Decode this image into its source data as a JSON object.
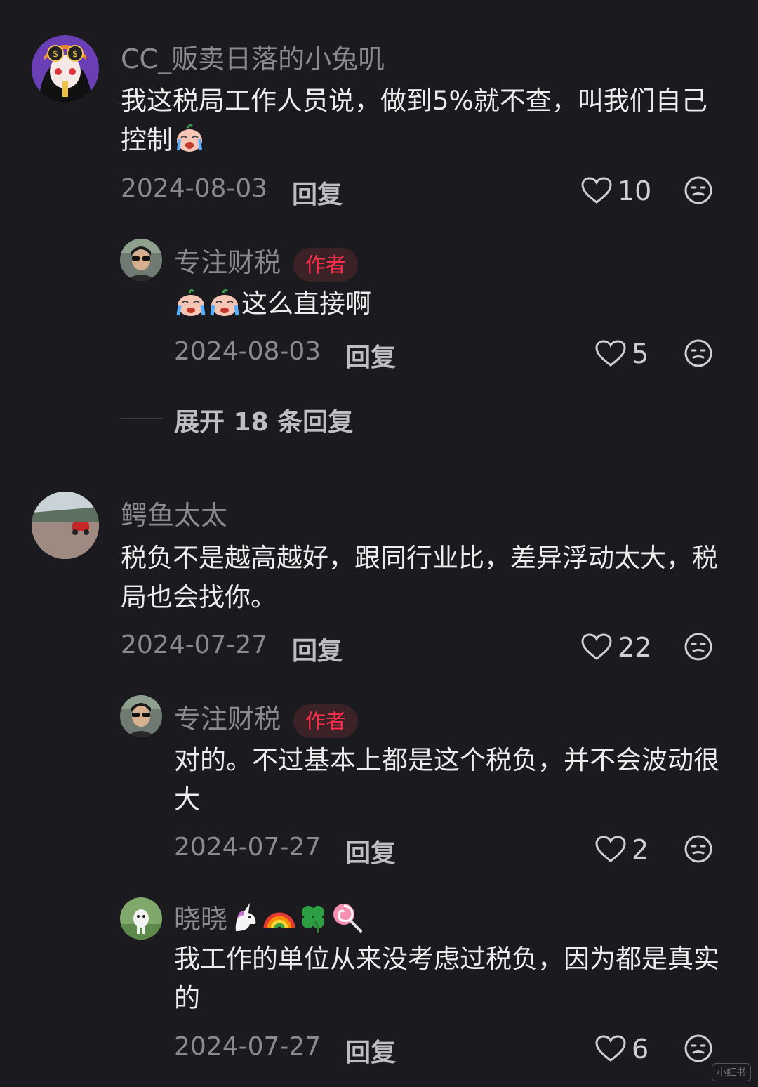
{
  "comments": [
    {
      "username": "CC_贩卖日落的小兔叽",
      "content": "我这税局工作人员说，做到5%就不查，叫我们自己控制",
      "date": "2024-08-03",
      "reply_label": "回复",
      "likes": "10",
      "replies": [
        {
          "username": "专注财税",
          "badge": "作者",
          "content": "这么直接啊",
          "date": "2024-08-03",
          "reply_label": "回复",
          "likes": "5"
        }
      ],
      "expand_label": "展开 18 条回复"
    },
    {
      "username": "鳄鱼太太",
      "content": "税负不是越高越好，跟同行业比，差异浮动太大，税局也会找你。",
      "date": "2024-07-27",
      "reply_label": "回复",
      "likes": "22",
      "replies": [
        {
          "username": "专注财税",
          "badge": "作者",
          "content": "对的。不过基本上都是这个税负，并不会波动很大",
          "date": "2024-07-27",
          "reply_label": "回复",
          "likes": "2"
        },
        {
          "username": "晓晓",
          "content": "我工作的单位从来没考虑过税负，因为都是真实的",
          "date": "2024-07-27",
          "reply_label": "回复",
          "likes": "6"
        }
      ]
    }
  ],
  "watermark": "小红书",
  "colors": {
    "background": "#1b1b1f",
    "author_badge": "#ff2d4a",
    "muted_text": "#8a8a90"
  }
}
